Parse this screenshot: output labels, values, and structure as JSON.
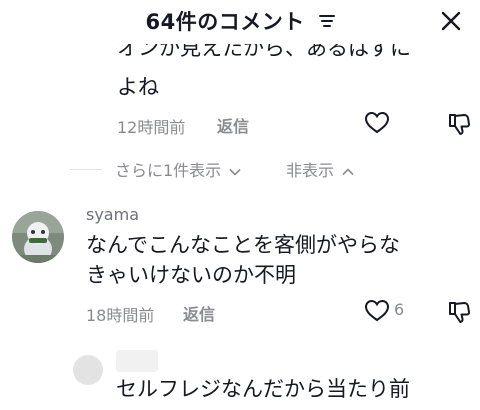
{
  "header": {
    "title": "64件のコメント",
    "sort_icon": "sort-icon",
    "close_icon": "close-icon"
  },
  "comments": [
    {
      "text_line1": "オンか見えたから、あるはずに",
      "text_line2": "よね",
      "time": "12時間前",
      "reply_label": "返信",
      "like_icon": "heart-icon",
      "dislike_icon": "thumbs-down-icon"
    },
    {
      "username": "syama",
      "text_line1": "なんでこんなことを客側がやらな",
      "text_line2": "きゃいけないのか不明",
      "time": "18時間前",
      "reply_label": "返信",
      "like_count": "6",
      "like_icon": "heart-icon",
      "dislike_icon": "thumbs-down-icon"
    },
    {
      "text": "セルフレジなんだから当たり前"
    }
  ],
  "replies_bar": {
    "show_more": "さらに1件表示",
    "hide": "非表示"
  }
}
